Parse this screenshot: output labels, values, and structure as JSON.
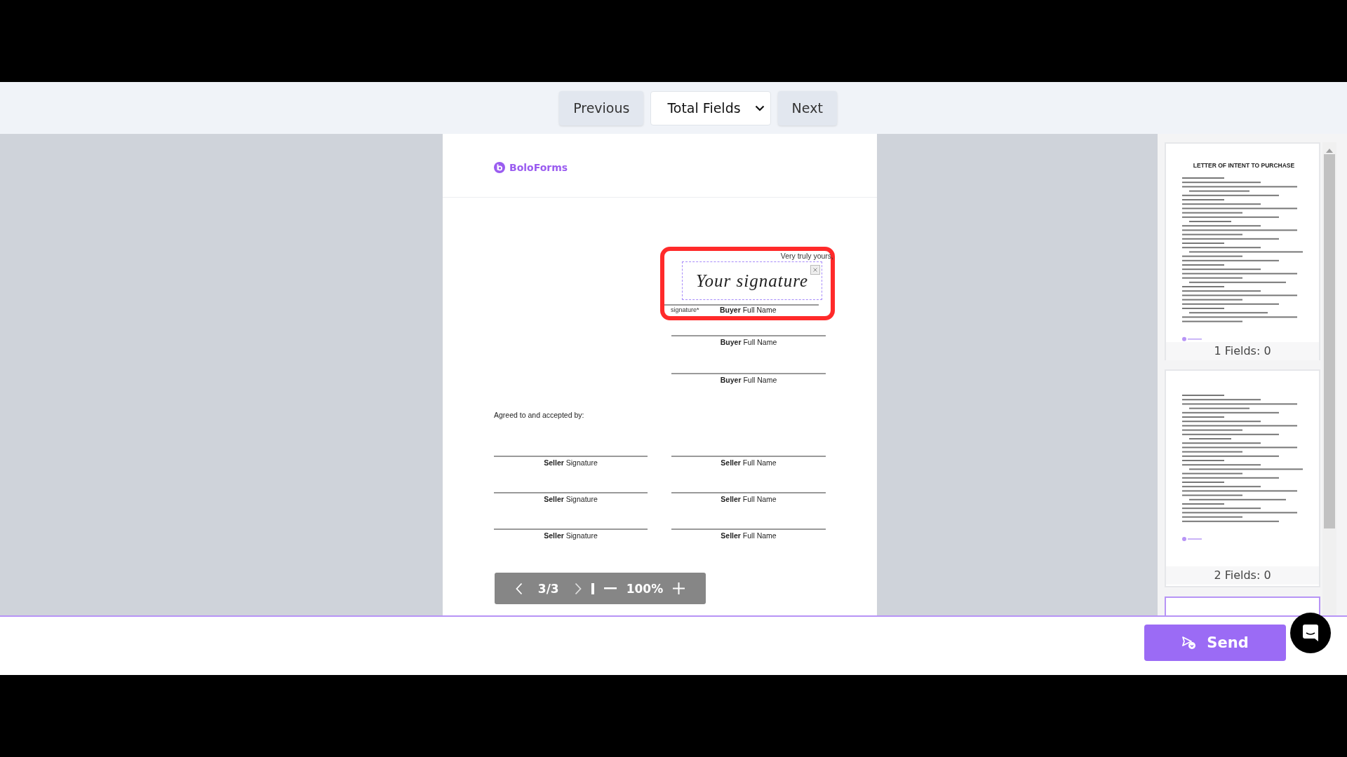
{
  "toolbar": {
    "previous": "Previous",
    "select": "Total Fields",
    "next": "Next"
  },
  "document": {
    "logo": "BoloForms",
    "signature_field": {
      "closing": "Very truly yours,",
      "signature": "Your signature",
      "field_label": "signature*",
      "caption": "**Buyer** Full Name",
      "highlighted": true
    },
    "buyer_lines": [
      {
        "caption": "**Buyer** Full Name"
      },
      {
        "caption": "**Buyer** Full Name"
      }
    ],
    "accept_text": "Agreed to and accepted by:",
    "seller_rows": [
      {
        "left": "**Seller** Signature",
        "right": "**Seller** Full Name"
      },
      {
        "left": "**Seller** Signature",
        "right": "**Seller** Full Name"
      },
      {
        "left": "**Seller** Signature",
        "right": "**Seller** Full Name"
      }
    ]
  },
  "pager": {
    "page": "3/3",
    "zoom": "100%"
  },
  "thumbnails": [
    {
      "title": "LETTER OF INTENT TO PURCHASE",
      "label": "1 Fields: 0",
      "selected": false
    },
    {
      "label": "2 Fields: 0",
      "selected": false
    },
    {
      "selected": true
    }
  ],
  "send": "Send"
}
